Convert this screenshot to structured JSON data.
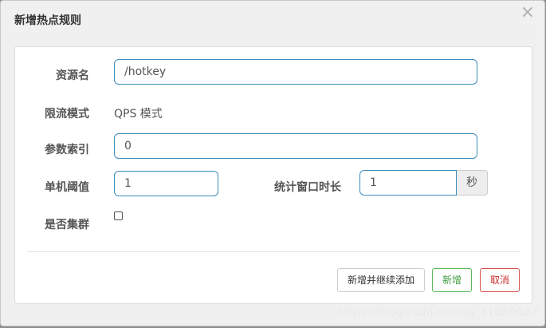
{
  "dialog": {
    "title": "新增热点规则",
    "close_glyph": "×"
  },
  "form": {
    "resource": {
      "label": "资源名",
      "value": "/hotkey"
    },
    "mode": {
      "label": "限流模式",
      "value": "QPS 模式"
    },
    "param_index": {
      "label": "参数索引",
      "value": "0"
    },
    "threshold": {
      "label": "单机阈值",
      "value": "1"
    },
    "window": {
      "label": "统计窗口时长",
      "value": "1",
      "unit": "秒"
    },
    "cluster": {
      "label": "是否集群",
      "checked": false
    }
  },
  "buttons": {
    "add_continue": "新增并继续添加",
    "add": "新增",
    "cancel": "取消"
  },
  "watermark": "https://blog.csdn.net/qq_31850627",
  "colors": {
    "input_border": "#3c8dbc",
    "success": "#5cb85c",
    "danger": "#d9534f"
  }
}
